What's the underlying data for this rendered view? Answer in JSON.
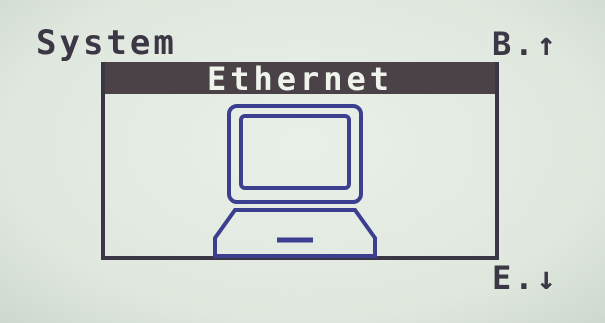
{
  "screen": {
    "title": "System",
    "nav_up_label": "B.↑",
    "nav_down_label": "E.↓"
  },
  "dialog": {
    "title": "Ethernet",
    "icon": "laptop-computer-icon"
  },
  "colors": {
    "lcd_background": "#e4ebe3",
    "text_dark": "#3b3745",
    "icon_blue": "#3c3f8f",
    "header_bar": "#4a4247",
    "header_text": "#eef3ec"
  }
}
